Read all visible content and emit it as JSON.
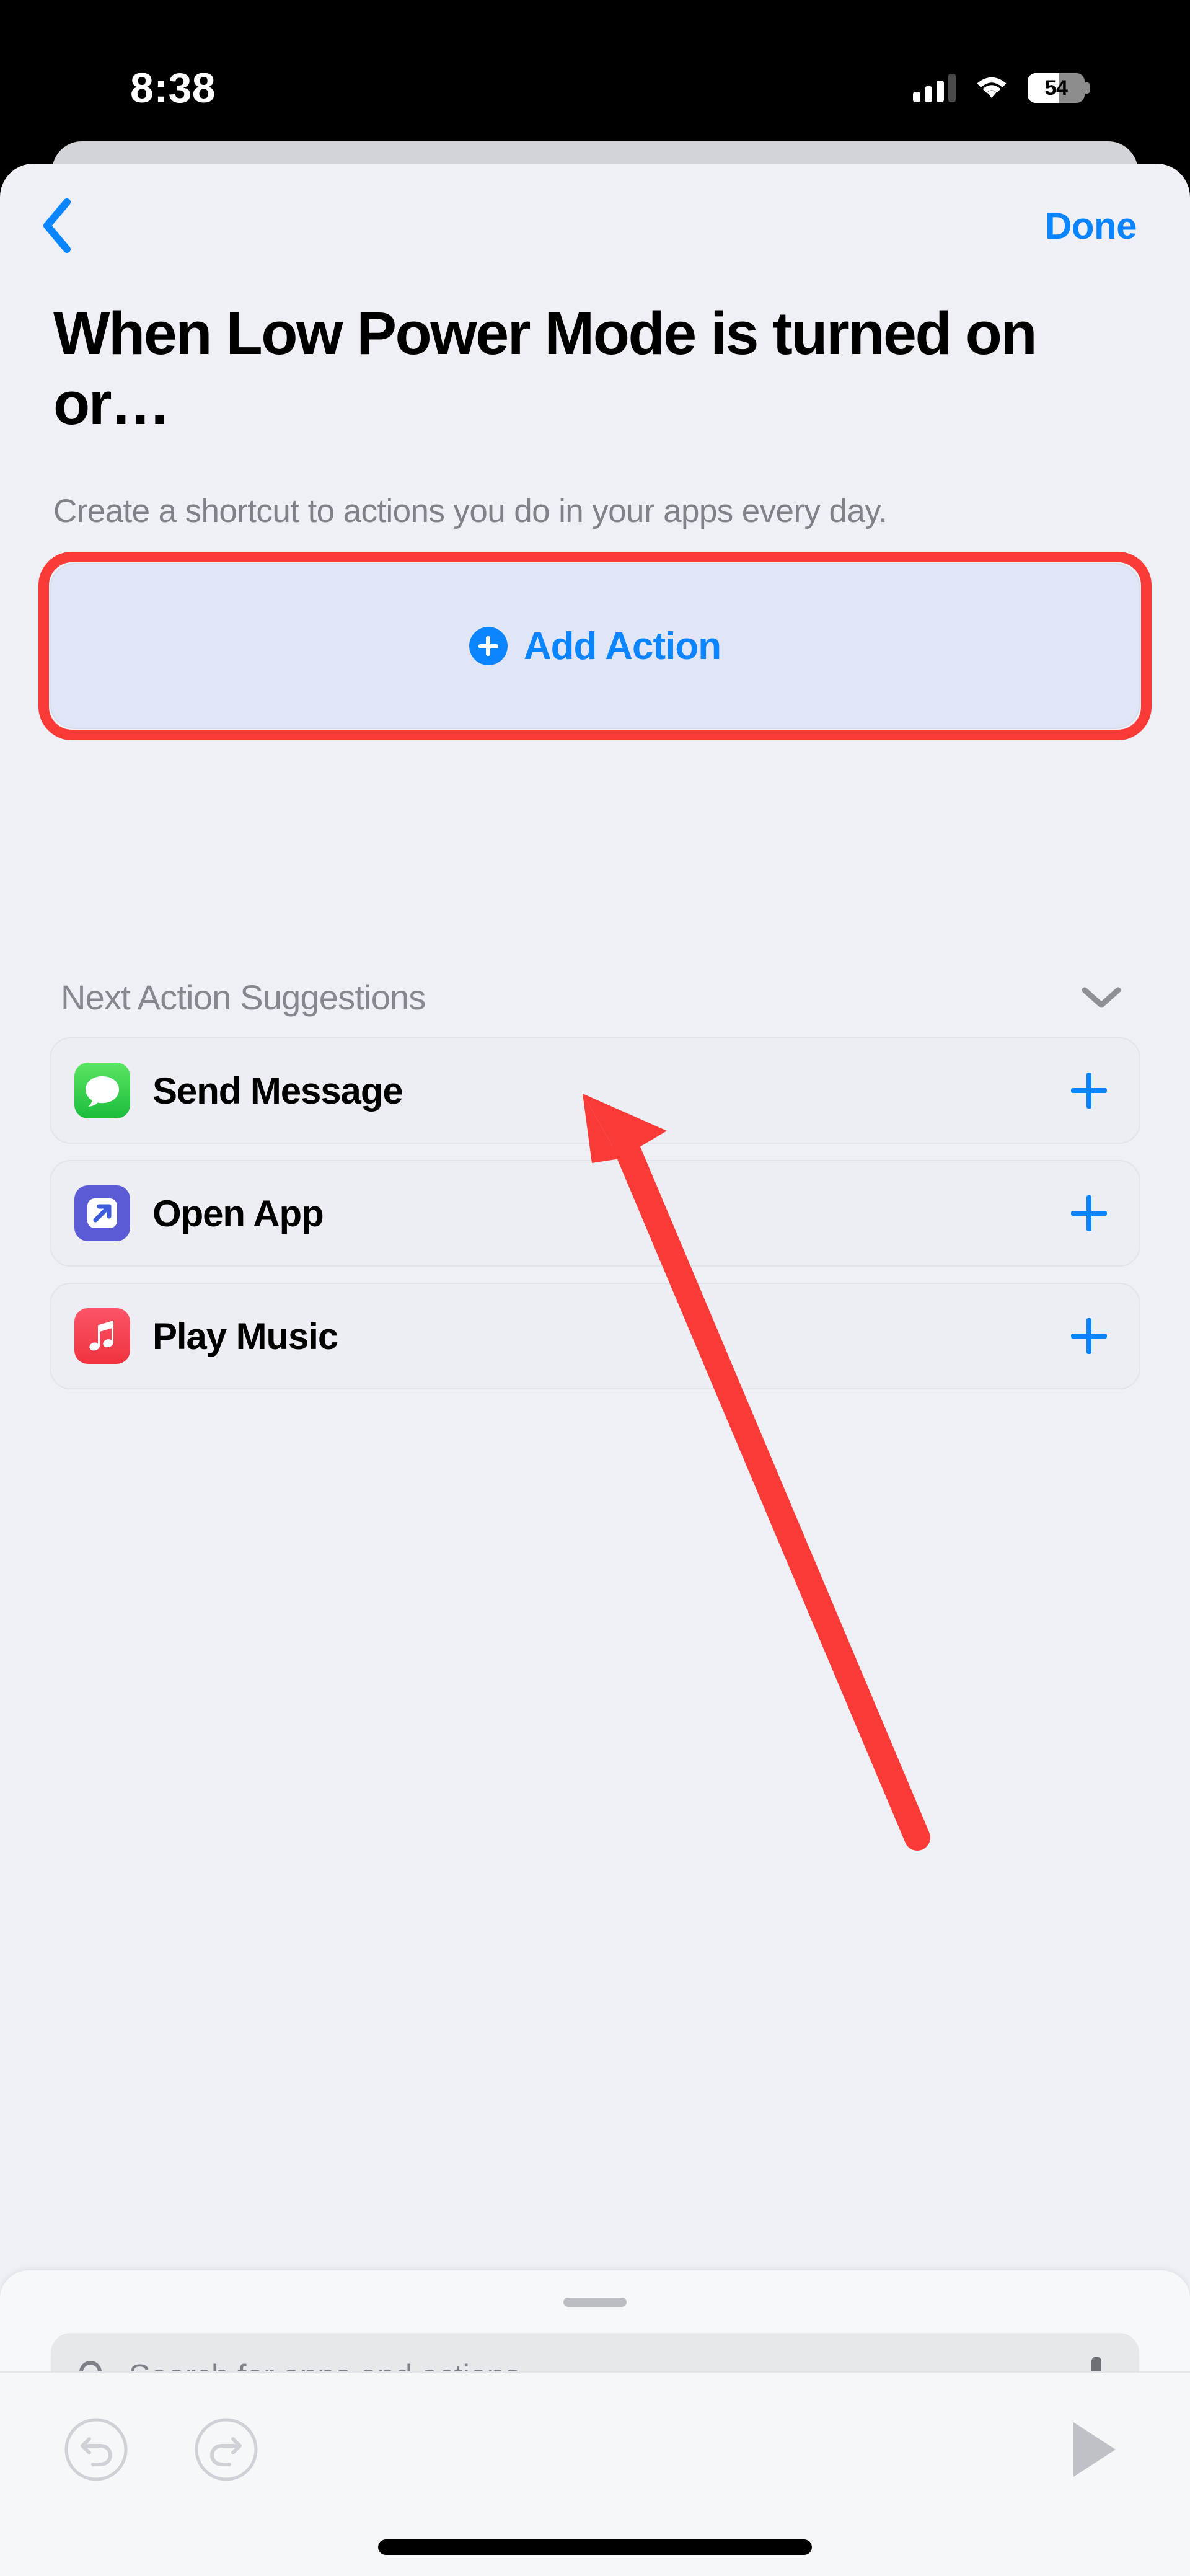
{
  "status_bar": {
    "time": "8:38",
    "signal_icon": "cellular-signal-icon",
    "signal_bars_filled": 3,
    "signal_bars_total": 4,
    "wifi_icon": "wifi-icon",
    "battery_icon": "battery-icon",
    "battery_percent": "54",
    "battery_level": 54
  },
  "nav": {
    "back_icon": "chevron-left-icon",
    "done_label": "Done"
  },
  "header": {
    "title": "When Low Power Mode is turned on or…",
    "subtitle": "Create a shortcut to actions you do in your apps every day."
  },
  "add_action": {
    "label": "Add Action",
    "plus_icon": "plus-circle-icon",
    "background_color": "#E0E6F5",
    "text_color": "#0A84FF"
  },
  "annotation": {
    "highlight_color": "#F93A36",
    "arrow_color": "#F93A36",
    "target": "Add Action"
  },
  "suggestions": {
    "title": "Next Action Suggestions",
    "collapse_icon": "chevron-down-icon",
    "items": [
      {
        "label": "Send Message",
        "icon": "messages-app-icon",
        "icon_color": "#30C24E",
        "add_icon": "plus-icon"
      },
      {
        "label": "Open App",
        "icon": "open-app-icon",
        "icon_color": "#5B5BD6",
        "add_icon": "plus-icon"
      },
      {
        "label": "Play Music",
        "icon": "music-app-icon",
        "icon_color": "#F0333F",
        "add_icon": "plus-icon"
      }
    ]
  },
  "search": {
    "placeholder": "Search for apps and actions",
    "value": "",
    "search_icon": "search-icon",
    "dictation_icon": "microphone-icon",
    "grabber": "sheet-grabber-handle"
  },
  "toolbar": {
    "undo_icon": "undo-icon",
    "redo_icon": "redo-icon",
    "run_icon": "play-icon"
  },
  "system": {
    "home_indicator": "home-indicator"
  }
}
